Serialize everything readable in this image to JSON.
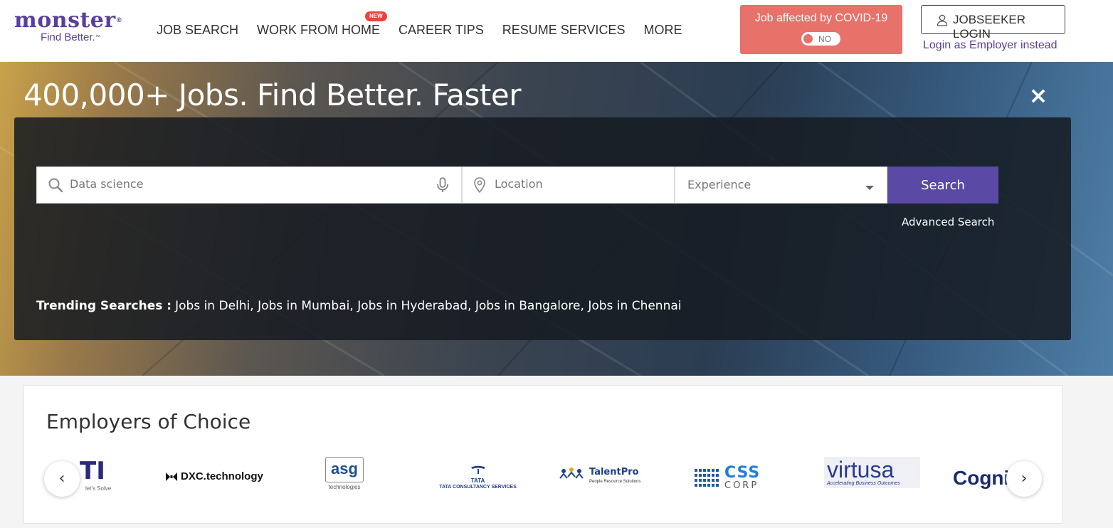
{
  "header": {
    "logo": {
      "brand": "monster",
      "tagline": "Find Better.",
      "tm": "™",
      "reg": "®"
    },
    "nav": [
      "JOB SEARCH",
      "WORK FROM HOME",
      "CAREER TIPS",
      "RESUME SERVICES",
      "MORE"
    ],
    "new_badge": "NEW",
    "covid": {
      "title": "Job affected by COVID-19",
      "toggle_value": "NO"
    },
    "login_label": "JOBSEEKER LOGIN",
    "employer_link": "Login as Employer instead"
  },
  "hero": {
    "title": "400,000+ Jobs. Find Better. Faster",
    "close_icon": "×",
    "search": {
      "keyword_value": "",
      "keyword_placeholder": "Data science",
      "location_value": "",
      "location_placeholder": "Location",
      "experience_placeholder": "Experience",
      "button_label": "Search",
      "advanced_link": "Advanced Search"
    },
    "trending": {
      "label": "Trending Searches :",
      "links": [
        "Jobs in Delhi,",
        "Jobs in Mumbai,",
        "Jobs in Hyderabad,",
        "Jobs in Bangalore,",
        "Jobs in Chennai"
      ]
    }
  },
  "employers": {
    "title": "Employers of Choice",
    "prev_icon": "‹",
    "next_icon": "›",
    "logos": [
      {
        "name": "TI",
        "caption": "let's Solve"
      },
      {
        "name": "DXC.technology"
      },
      {
        "name": "asg",
        "caption": "technologies"
      },
      {
        "name": "TATA",
        "caption": "TATA CONSULTANCY SERVICES"
      },
      {
        "name": "TalentPro",
        "caption": "People Resource Solutions"
      },
      {
        "name": "CSS",
        "caption": "CORP"
      },
      {
        "name": "virtusa",
        "caption": "Accelerating Business Outcomes"
      },
      {
        "name": "Cogni"
      }
    ]
  },
  "colors": {
    "brand_purple": "#5a3f9e",
    "search_button": "#5b49a6",
    "covid_bg": "#e8716a"
  }
}
